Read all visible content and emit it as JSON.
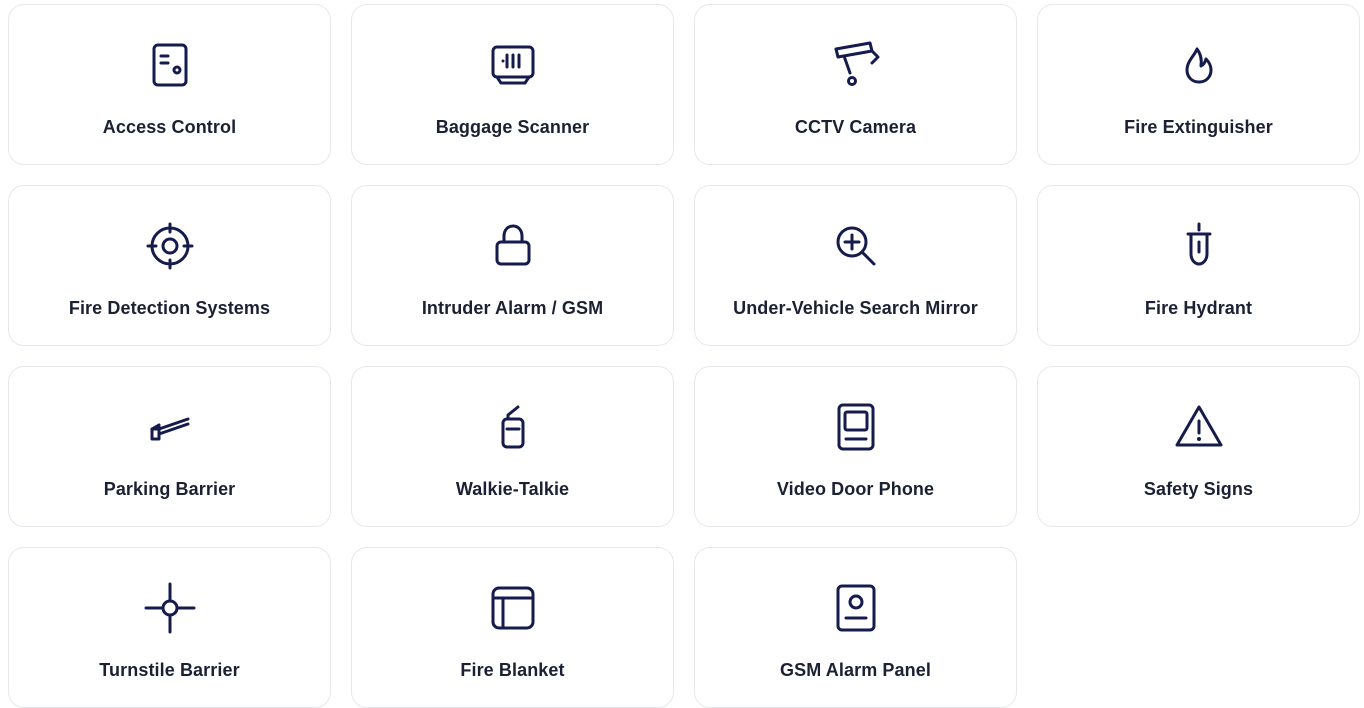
{
  "colors": {
    "icon": "#161b4d",
    "label": "#1b2033",
    "border": "#e6e8ee",
    "background": "#ffffff"
  },
  "items": [
    {
      "label": "Access Control",
      "icon": "access-control-icon"
    },
    {
      "label": "Baggage Scanner",
      "icon": "baggage-scanner-icon"
    },
    {
      "label": "CCTV Camera",
      "icon": "cctv-camera-icon"
    },
    {
      "label": "Fire Extinguisher",
      "icon": "flame-icon"
    },
    {
      "label": "Fire Detection Systems",
      "icon": "target-crosshair-icon"
    },
    {
      "label": "Intruder Alarm / GSM",
      "icon": "lock-icon"
    },
    {
      "label": "Under-Vehicle Search Mirror",
      "icon": "zoom-in-icon"
    },
    {
      "label": "Fire Hydrant",
      "icon": "fire-hydrant-icon"
    },
    {
      "label": "Parking Barrier",
      "icon": "parking-barrier-icon"
    },
    {
      "label": "Walkie-Talkie",
      "icon": "walkie-talkie-icon"
    },
    {
      "label": "Video Door Phone",
      "icon": "video-door-phone-icon"
    },
    {
      "label": "Safety Signs",
      "icon": "warning-triangle-icon"
    },
    {
      "label": "Turnstile Barrier",
      "icon": "turnstile-icon"
    },
    {
      "label": "Fire Blanket",
      "icon": "fire-blanket-icon"
    },
    {
      "label": "GSM Alarm Panel",
      "icon": "alarm-panel-icon"
    }
  ]
}
